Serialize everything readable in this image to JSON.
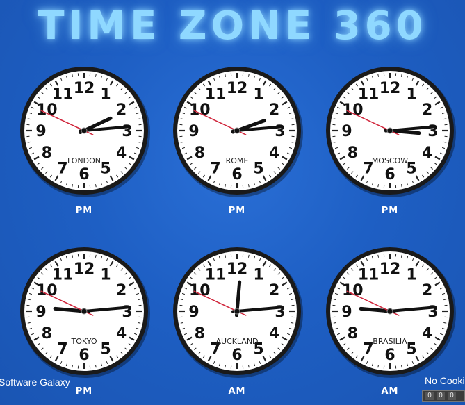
{
  "app": {
    "title": "TIME ZONE 360"
  },
  "clocks": [
    {
      "city": "LONDON",
      "ampm": "PM",
      "hour_angle": 65,
      "minute_angle": 85,
      "second_angle": 295
    },
    {
      "city": "ROME",
      "ampm": "PM",
      "hour_angle": 70,
      "minute_angle": 85,
      "second_angle": 295
    },
    {
      "city": "MOSCOW",
      "ampm": "PM",
      "hour_angle": 95,
      "minute_angle": 85,
      "second_angle": 295
    },
    {
      "city": "TOKYO",
      "ampm": "PM",
      "hour_angle": 275,
      "minute_angle": 85,
      "second_angle": 295
    },
    {
      "city": "AUCKLAND",
      "ampm": "AM",
      "hour_angle": 5,
      "minute_angle": 85,
      "second_angle": 295
    },
    {
      "city": "BRASILIA",
      "ampm": "AM",
      "hour_angle": 275,
      "minute_angle": 85,
      "second_angle": 295
    }
  ],
  "dial_numbers": [
    "12",
    "1",
    "2",
    "3",
    "4",
    "5",
    "6",
    "7",
    "8",
    "9",
    "10",
    "11"
  ],
  "footer": {
    "left_text": "Software Galaxy",
    "right_text": "No Cookie"
  },
  "colors": {
    "second_hand": "#d0243a",
    "hand": "#111111",
    "rim": "#1a1a1a",
    "face": "#ffffff"
  }
}
